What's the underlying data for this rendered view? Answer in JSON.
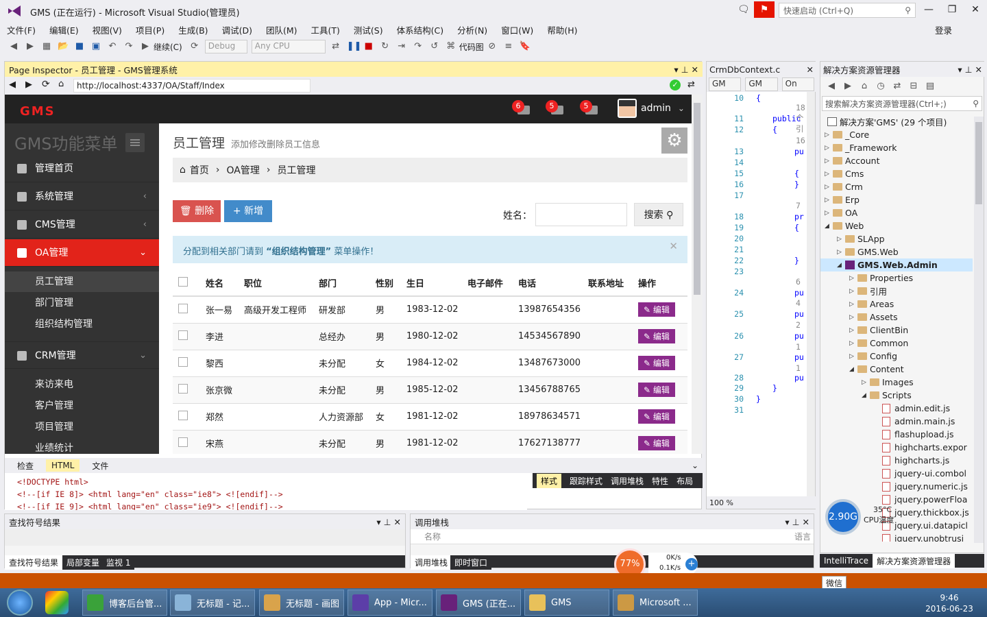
{
  "app": {
    "title": "GMS (正在运行) - Microsoft Visual Studio(管理员)",
    "quick_launch": "快速启动 (Ctrl+Q)",
    "login": "登录"
  },
  "menu": [
    "文件(F)",
    "编辑(E)",
    "视图(V)",
    "项目(P)",
    "生成(B)",
    "调试(D)",
    "团队(M)",
    "工具(T)",
    "测试(S)",
    "体系结构(C)",
    "分析(N)",
    "窗口(W)",
    "帮助(H)"
  ],
  "toolbar": {
    "continue": "继续(C)",
    "config": "Debug",
    "platform": "Any CPU",
    "codemap": "代码图"
  },
  "inspector": {
    "title": "Page Inspector - 员工管理 - GMS管理系统",
    "url": "http://localhost:4337/OA/Staff/Index"
  },
  "web": {
    "logo": "GMS",
    "notifications": [
      "6",
      "5",
      "5"
    ],
    "username": "admin",
    "menu_title": "GMS功能菜单",
    "menu": [
      {
        "label": "管理首页"
      },
      {
        "label": "系统管理"
      },
      {
        "label": "CMS管理"
      },
      {
        "label": "OA管理"
      }
    ],
    "oa_sub": [
      "员工管理",
      "部门管理",
      "组织结构管理"
    ],
    "crm": "CRM管理",
    "crm_sub": [
      "来访来电",
      "客户管理",
      "项目管理",
      "业绩统计"
    ],
    "page_title": "员工管理",
    "page_sub": "添加修改删除员工信息",
    "breadcrumb": [
      "首页",
      "OA管理",
      "员工管理"
    ],
    "delete_btn": "删除",
    "add_btn": "新增",
    "name_label": "姓名：",
    "search_btn": "搜索",
    "alert_pre": "分配到相关部门请到 ",
    "alert_bold": "“组织结构管理”",
    "alert_post": " 菜单操作！",
    "columns": [
      "姓名",
      "职位",
      "部门",
      "性别",
      "生日",
      "电子邮件",
      "电话",
      "联系地址",
      "操作"
    ],
    "edit_label": "编辑",
    "rows": [
      [
        "张一易",
        "高级开发工程师",
        "研发部",
        "男",
        "1983-12-02",
        "",
        "13987654356",
        ""
      ],
      [
        "李进",
        "",
        "总经办",
        "男",
        "1980-12-02",
        "",
        "14534567890",
        ""
      ],
      [
        "黎西",
        "",
        "未分配",
        "女",
        "1984-12-02",
        "",
        "13487673000",
        ""
      ],
      [
        "张京微",
        "",
        "未分配",
        "男",
        "1985-12-02",
        "",
        "13456788765",
        ""
      ],
      [
        "郑然",
        "",
        "人力资源部",
        "女",
        "1981-12-02",
        "",
        "18978634571",
        ""
      ],
      [
        "宋燕",
        "",
        "未分配",
        "男",
        "1981-12-02",
        "",
        "17627138777",
        ""
      ]
    ]
  },
  "inspector_tabs": [
    "检查",
    "HTML",
    "文件"
  ],
  "html_lines": [
    "<!DOCTYPE html>",
    "<!--[if IE 8]> <html lang=\"en\" class=\"ie8\"> <![endif]-->",
    "<!--[if IE 9]> <html lang=\"en\" class=\"ie9\"> <![endif]-->"
  ],
  "style_tabs": [
    "样式",
    "跟踪样式",
    "调用堆栈",
    "特性",
    "布局"
  ],
  "code": {
    "tab": "CrmDbContext.c",
    "drops": [
      "GM",
      "GM",
      "On"
    ],
    "zoom": "100 %",
    "lines": [
      {
        "n": "10",
        "t": "{"
      },
      {
        "n": "",
        "t": "18 个引"
      },
      {
        "n": "11",
        "t": "public"
      },
      {
        "n": "12",
        "t": "{"
      },
      {
        "n": "",
        "t": "16"
      },
      {
        "n": "13",
        "t": "pu"
      },
      {
        "n": "14",
        "t": ""
      },
      {
        "n": "15",
        "t": "{"
      },
      {
        "n": "16",
        "t": "}"
      },
      {
        "n": "17",
        "t": ""
      },
      {
        "n": "",
        "t": "7"
      },
      {
        "n": "18",
        "t": "pr"
      },
      {
        "n": "19",
        "t": "{"
      },
      {
        "n": "20",
        "t": ""
      },
      {
        "n": "21",
        "t": ""
      },
      {
        "n": "22",
        "t": "}"
      },
      {
        "n": "23",
        "t": ""
      },
      {
        "n": "",
        "t": "6"
      },
      {
        "n": "24",
        "t": "pu"
      },
      {
        "n": "",
        "t": "4"
      },
      {
        "n": "25",
        "t": "pu"
      },
      {
        "n": "",
        "t": "2"
      },
      {
        "n": "26",
        "t": "pu"
      },
      {
        "n": "",
        "t": "1"
      },
      {
        "n": "27",
        "t": "pu"
      },
      {
        "n": "",
        "t": "1"
      },
      {
        "n": "28",
        "t": "pu"
      },
      {
        "n": "29",
        "t": "}"
      },
      {
        "n": "30",
        "t": "}"
      },
      {
        "n": "31",
        "t": ""
      }
    ]
  },
  "solution": {
    "title": "解决方案资源管理器",
    "search": "搜索解决方案资源管理器(Ctrl+;)",
    "root": "解决方案'GMS' (29 个项目)",
    "items": [
      {
        "label": "_Core",
        "kind": "folder"
      },
      {
        "label": "_Framework",
        "kind": "folder"
      },
      {
        "label": "Account",
        "kind": "folder"
      },
      {
        "label": "Cms",
        "kind": "folder"
      },
      {
        "label": "Crm",
        "kind": "folder"
      },
      {
        "label": "Erp",
        "kind": "folder"
      },
      {
        "label": "OA",
        "kind": "folder"
      },
      {
        "label": "Web",
        "kind": "folder"
      },
      {
        "label": "SLApp",
        "kind": "folder"
      },
      {
        "label": "GMS.Web",
        "kind": "folder"
      },
      {
        "label": "GMS.Web.Admin",
        "kind": "project"
      },
      {
        "label": "Properties",
        "kind": "folder"
      },
      {
        "label": "引用",
        "kind": "folder"
      },
      {
        "label": "Areas",
        "kind": "folder"
      },
      {
        "label": "Assets",
        "kind": "folder"
      },
      {
        "label": "ClientBin",
        "kind": "folder"
      },
      {
        "label": "Common",
        "kind": "folder"
      },
      {
        "label": "Config",
        "kind": "folder"
      },
      {
        "label": "Content",
        "kind": "folder"
      },
      {
        "label": "Images",
        "kind": "folder"
      },
      {
        "label": "Scripts",
        "kind": "folder"
      },
      {
        "label": "admin.edit.js",
        "kind": "js"
      },
      {
        "label": "admin.main.js",
        "kind": "js"
      },
      {
        "label": "flashupload.js",
        "kind": "js"
      },
      {
        "label": "highcharts.expor",
        "kind": "js"
      },
      {
        "label": "highcharts.js",
        "kind": "js"
      },
      {
        "label": "jquery-ui.combol",
        "kind": "js"
      },
      {
        "label": "jquery.numeric.js",
        "kind": "js"
      },
      {
        "label": "jquery.powerFloa",
        "kind": "js"
      },
      {
        "label": "jquery.thickbox.js",
        "kind": "js"
      },
      {
        "label": "jquery.ui.datapicl",
        "kind": "js"
      },
      {
        "label": "iquery.unobtrusi",
        "kind": "js"
      }
    ],
    "bottom_tabs": [
      "IntelliTrace",
      "解决方案资源管理器"
    ]
  },
  "find_panel": {
    "title": "查找符号结果",
    "tabs": [
      "查找符号结果",
      "局部变量",
      "监视 1"
    ]
  },
  "callstack_panel": {
    "title": "调用堆栈",
    "col_name": "名称",
    "col_lang": "语言",
    "tabs": [
      "调用堆栈",
      "即时窗口"
    ]
  },
  "widgets": {
    "cpu_freq": "2.90G",
    "cpu_temp": "35°C",
    "cpu_label": "CPU温度",
    "net_pct": "77%",
    "up": "0K/s",
    "down": "0.1K/s",
    "weixin_tip": "微信"
  },
  "taskbar": [
    {
      "label": "博客后台管...",
      "color": "#3aa23a"
    },
    {
      "label": "无标题 - 记...",
      "color": "#8ab4d8"
    },
    {
      "label": "无标题 - 画图",
      "color": "#d9a34b"
    },
    {
      "label": "App - Micr...",
      "color": "#5c3ea8"
    },
    {
      "label": "GMS (正在...",
      "color": "#68217a"
    },
    {
      "label": "GMS",
      "color": "#e8c15a"
    },
    {
      "label": "Microsoft ...",
      "color": "#c94"
    }
  ],
  "clock": {
    "time": "9:46",
    "date": "2016-06-23"
  }
}
